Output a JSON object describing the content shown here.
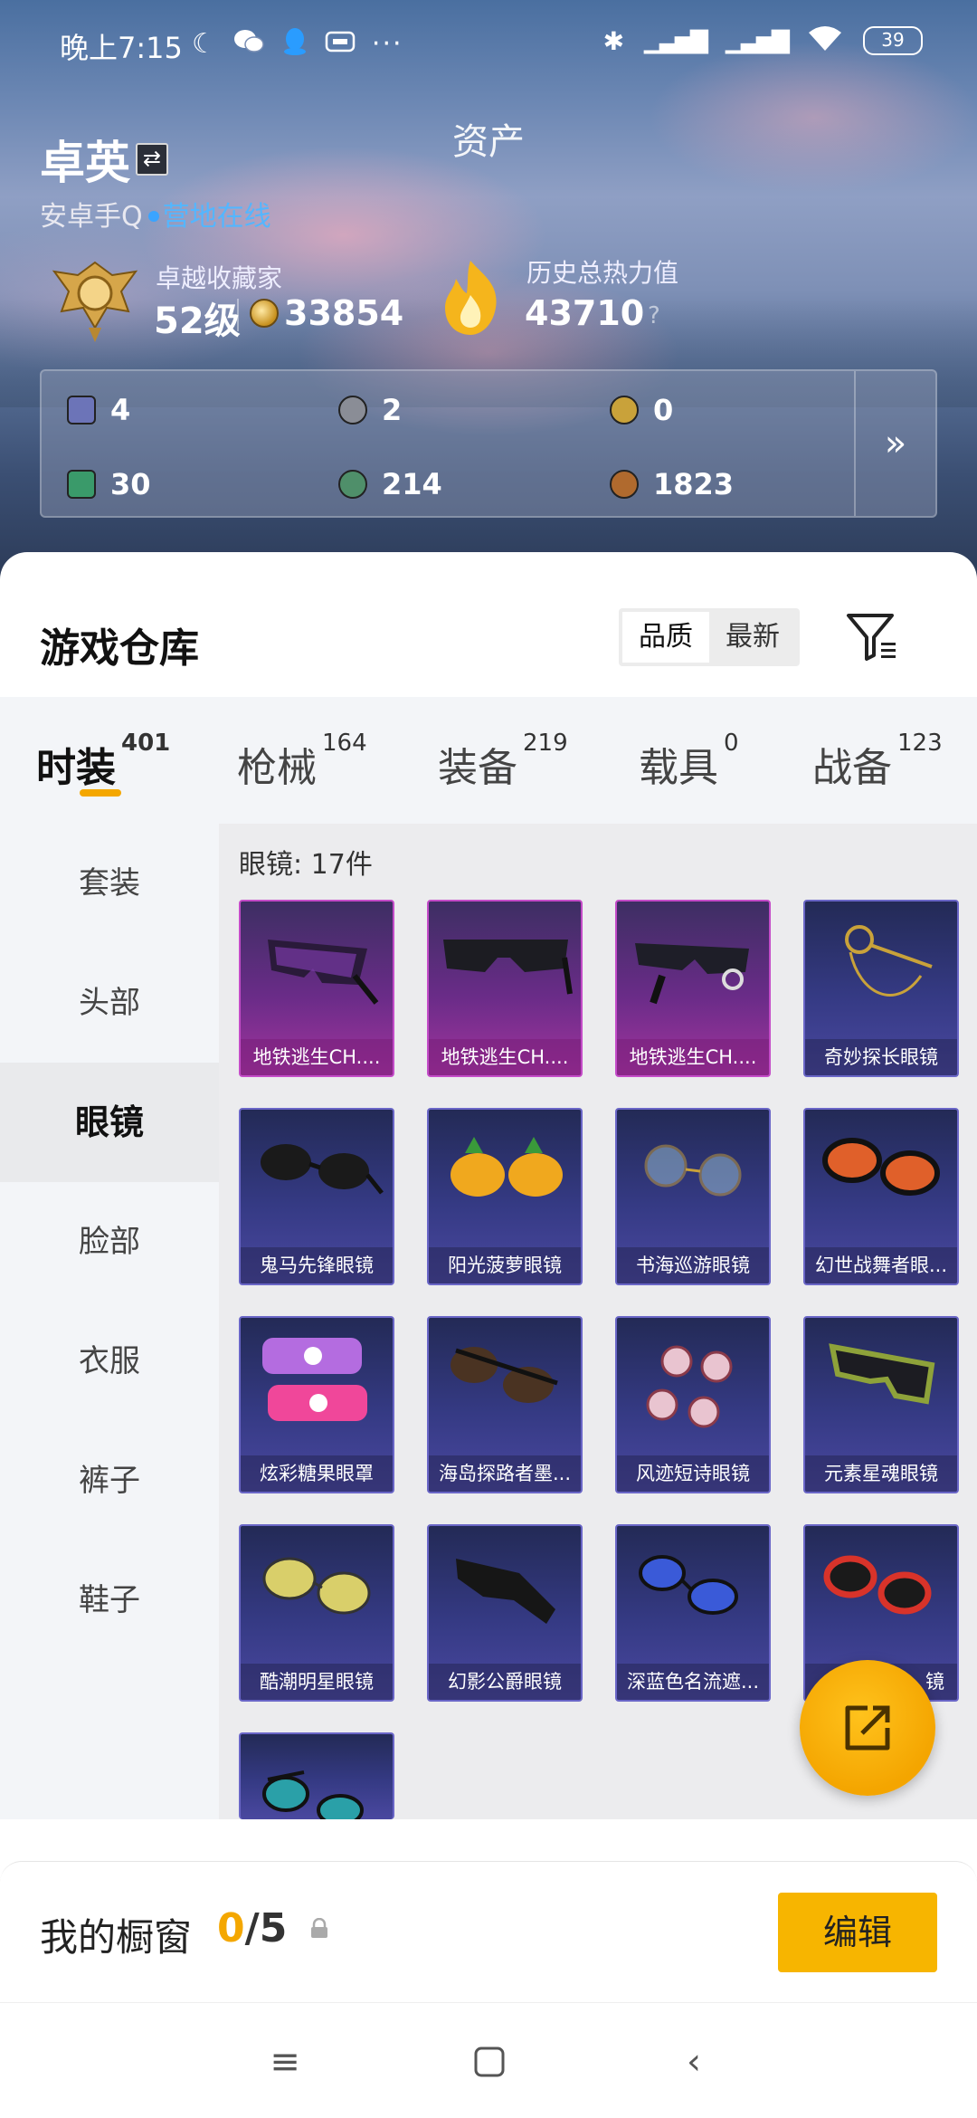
{
  "statusbar": {
    "time": "晚上7:15",
    "battery": "39"
  },
  "header": {
    "page_title": "资产",
    "user_name": "卓英",
    "platform": "安卓手Q",
    "online_status": "营地在线"
  },
  "rank": {
    "label": "卓越收藏家",
    "level": "52级",
    "coins": "33854"
  },
  "heat": {
    "label": "历史总热力值",
    "value": "43710",
    "help": "?"
  },
  "stats": [
    {
      "icon": "purple-card-icon",
      "value": "4",
      "color": "#6c74b8"
    },
    {
      "icon": "silver-coin-icon",
      "value": "2",
      "color": "#8a8d96"
    },
    {
      "icon": "gold-token-icon",
      "value": "0",
      "color": "#c9a23a"
    },
    {
      "icon": "green-card-icon",
      "value": "30",
      "color": "#3a9a6a"
    },
    {
      "icon": "jade-coin-icon",
      "value": "214",
      "color": "#4f8f6a"
    },
    {
      "icon": "bronze-coin-icon",
      "value": "1823",
      "color": "#b06a2e"
    }
  ],
  "warehouse": {
    "title": "游戏仓库",
    "sort_options": [
      "品质",
      "最新"
    ],
    "sort_selected": "品质"
  },
  "categories": [
    {
      "label": "时装",
      "count": "401"
    },
    {
      "label": "枪械",
      "count": "164"
    },
    {
      "label": "装备",
      "count": "219"
    },
    {
      "label": "载具",
      "count": "0"
    },
    {
      "label": "战备",
      "count": "123"
    }
  ],
  "subcategories": [
    "套装",
    "头部",
    "眼镜",
    "脸部",
    "衣服",
    "裤子",
    "鞋子"
  ],
  "selected_subcategory": "眼镜",
  "content": {
    "count_label": "眼镜: 17件"
  },
  "items": [
    {
      "name": "地铁逃生CH....",
      "rarity": "purple"
    },
    {
      "name": "地铁逃生CH....",
      "rarity": "purple"
    },
    {
      "name": "地铁逃生CH....",
      "rarity": "purple"
    },
    {
      "name": "奇妙探长眼镜",
      "rarity": "blue"
    },
    {
      "name": "鬼马先锋眼镜",
      "rarity": "blue"
    },
    {
      "name": "阳光菠萝眼镜",
      "rarity": "blue"
    },
    {
      "name": "书海巡游眼镜",
      "rarity": "blue"
    },
    {
      "name": "幻世战舞者眼...",
      "rarity": "blue"
    },
    {
      "name": "炫彩糖果眼罩",
      "rarity": "blue"
    },
    {
      "name": "海岛探路者墨...",
      "rarity": "blue"
    },
    {
      "name": "风迹短诗眼镜",
      "rarity": "blue"
    },
    {
      "name": "元素星魂眼镜",
      "rarity": "blue"
    },
    {
      "name": "酷潮明星眼镜",
      "rarity": "blue"
    },
    {
      "name": "幻影公爵眼镜",
      "rarity": "blue"
    },
    {
      "name": "深蓝色名流遮...",
      "rarity": "blue"
    },
    {
      "name": "镜",
      "rarity": "blue"
    },
    {
      "name": "",
      "rarity": "blue"
    }
  ],
  "showcase": {
    "label": "我的橱窗",
    "current": "0",
    "total": "/5",
    "edit_label": "编辑"
  }
}
